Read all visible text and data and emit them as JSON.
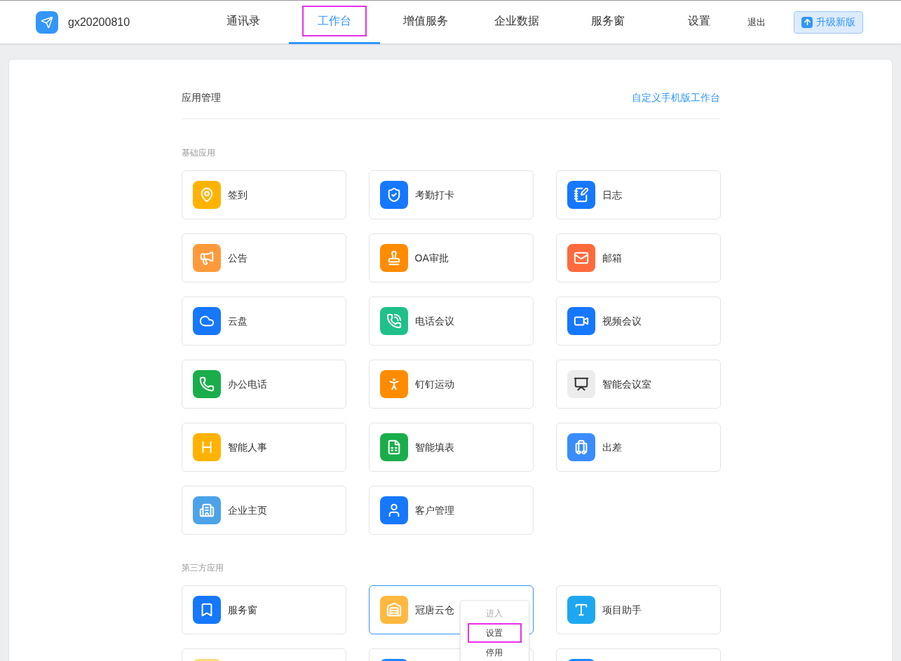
{
  "header": {
    "org_name": "gx20200810",
    "nav": [
      {
        "label": "通讯录",
        "selected": false,
        "annotated": false
      },
      {
        "label": "工作台",
        "selected": true,
        "annotated": true
      },
      {
        "label": "增值服务",
        "selected": false,
        "annotated": false
      },
      {
        "label": "企业数据",
        "selected": false,
        "annotated": false
      },
      {
        "label": "服务窗",
        "selected": false,
        "annotated": false
      },
      {
        "label": "设置",
        "selected": false,
        "annotated": false
      }
    ],
    "logout": "退出",
    "upgrade_button": "升级新版"
  },
  "panel": {
    "title": "应用管理",
    "link": "自定义手机版工作台",
    "sections": [
      {
        "label": "基础应用",
        "apps": [
          {
            "name": "签到",
            "color": "#ffb300",
            "hovered": false
          },
          {
            "name": "考勤打卡",
            "color": "#1677ff",
            "hovered": false
          },
          {
            "name": "日志",
            "color": "#1677ff",
            "hovered": false
          },
          {
            "name": "公告",
            "color": "#ff9a3c",
            "hovered": false
          },
          {
            "name": "OA审批",
            "color": "#ff8c00",
            "hovered": false
          },
          {
            "name": "邮箱",
            "color": "#ff6a3d",
            "hovered": false
          },
          {
            "name": "云盘",
            "color": "#1677ff",
            "hovered": false
          },
          {
            "name": "电话会议",
            "color": "#1fc08a",
            "hovered": false
          },
          {
            "name": "视频会议",
            "color": "#1677ff",
            "hovered": false
          },
          {
            "name": "办公电话",
            "color": "#1aad4b",
            "hovered": false
          },
          {
            "name": "钉钉运动",
            "color": "#ff8c00",
            "hovered": false
          },
          {
            "name": "智能会议室",
            "color": "#ececec",
            "hovered": false
          },
          {
            "name": "智能人事",
            "color": "#ffb300",
            "hovered": false
          },
          {
            "name": "智能填表",
            "color": "#1aad4b",
            "hovered": false
          },
          {
            "name": "出差",
            "color": "#3b8cff",
            "hovered": false
          },
          {
            "name": "企业主页",
            "color": "#4da3e8",
            "hovered": false
          },
          {
            "name": "客户管理",
            "color": "#1677ff",
            "hovered": false
          }
        ]
      },
      {
        "label": "第三方应用",
        "apps": [
          {
            "name": "服务窗",
            "color": "#1677ff",
            "hovered": false
          },
          {
            "name": "冠唐云仓",
            "color": "#ffb840",
            "hovered": true,
            "menu": [
              {
                "label": "进入",
                "disabled": true,
                "annotated": false
              },
              {
                "label": "设置",
                "disabled": false,
                "annotated": true
              },
              {
                "label": "停用",
                "disabled": false,
                "annotated": false
              }
            ]
          },
          {
            "name": "项目助手",
            "color": "#1ea7f0",
            "hovered": false
          },
          {
            "color": "#ffd97a",
            "hovered": false
          },
          {
            "color": "#1a8cff",
            "hovered": false
          },
          {
            "color": "#1a8cff",
            "hovered": false
          }
        ]
      }
    ]
  }
}
